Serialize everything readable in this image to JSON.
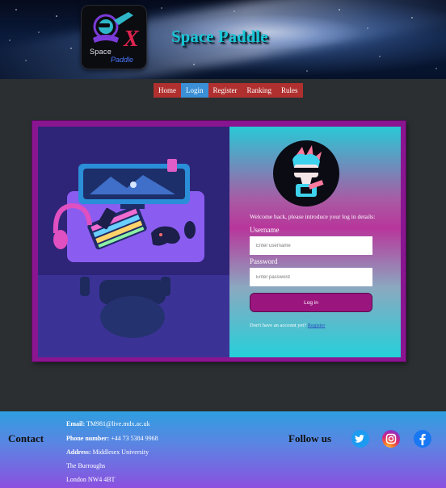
{
  "header": {
    "site_title": "Space Paddle",
    "logo": {
      "word_1": "Space",
      "letter": "X",
      "word_2": "Paddle"
    }
  },
  "nav": {
    "items": [
      {
        "label": "Home",
        "active": false
      },
      {
        "label": "Login",
        "active": true
      },
      {
        "label": "Register",
        "active": false
      },
      {
        "label": "Ranking",
        "active": false
      },
      {
        "label": "Rules",
        "active": false
      }
    ]
  },
  "login": {
    "welcome_text": "Welcome back, please introduce your log in details:",
    "username_label": "Username",
    "username_placeholder": "Enter username",
    "password_label": "Password",
    "password_placeholder": "Enter password",
    "submit_label": "Log in",
    "signup_prompt": "Don't have an account yet?",
    "signup_link": "Register"
  },
  "footer": {
    "contact_heading": "Contact",
    "email_label": "Email:",
    "email_value": "TM981@live.mdx.ac.uk",
    "phone_label": "Phone number:",
    "phone_value": "+44 73 5384 9968",
    "address_label": "Address:",
    "address_line_1": "Middlesex University",
    "address_line_2": "The Burroughs",
    "address_line_3": "London NW4 4BT",
    "follow_heading": "Follow us",
    "social": [
      {
        "name": "twitter-icon",
        "color": "#1d9bf0"
      },
      {
        "name": "instagram-icon",
        "color": "#d62976"
      },
      {
        "name": "facebook-icon",
        "color": "#1877f2"
      }
    ]
  },
  "colors": {
    "page_background": "#2b2f31",
    "nav_item": "#b0302f",
    "nav_active": "#3a8fd6",
    "card_frame": "#8a1590",
    "title": "#19c6d6",
    "login_button": "#9a167e"
  }
}
